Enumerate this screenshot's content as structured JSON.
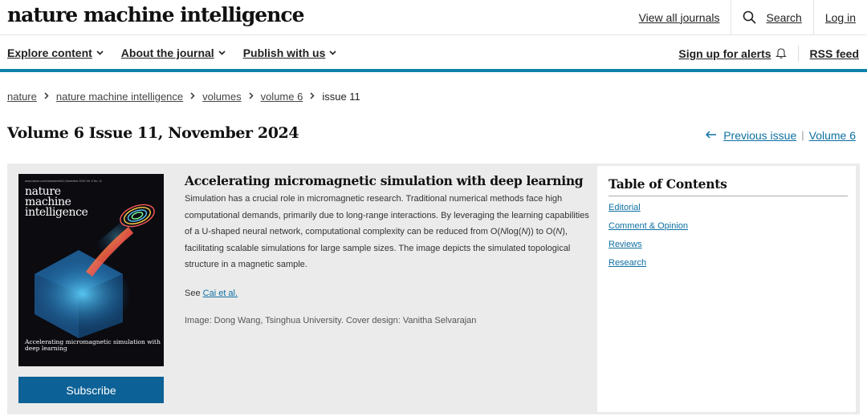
{
  "header": {
    "logo": "nature machine intelligence",
    "links": {
      "view_all": "View all journals",
      "search": "Search",
      "login": "Log in"
    }
  },
  "nav": {
    "items": [
      "Explore content",
      "About the journal",
      "Publish with us"
    ],
    "alerts": "Sign up for alerts",
    "rss": "RSS feed"
  },
  "breadcrumb": [
    "nature",
    "nature machine intelligence",
    "volumes",
    "volume 6",
    "issue 11"
  ],
  "page": {
    "title": "Volume 6 Issue 11, November 2024",
    "previous_issue": "Previous issue",
    "volume_link": "Volume 6"
  },
  "cover": {
    "top_text": "www.nature.com/natmachintell | November 2024 Vol. 6 No. 11",
    "title": "nature machine intelligence",
    "caption": "Accelerating micromagnetic simulation with deep learning",
    "subscribe": "Subscribe"
  },
  "article": {
    "title": "Accelerating micromagnetic simulation with deep learning",
    "desc_1": "Simulation has a crucial role in micromagnetic research. Traditional numerical methods face high computational demands, primarily due to long-range interactions. By leveraging the learning capabilities of a U-shaped neural network, computational complexity can be reduced from O(",
    "desc_n1": "N",
    "desc_2": "log(",
    "desc_n2": "N",
    "desc_3": ")) to O(",
    "desc_n3": "N",
    "desc_4": "), facilitating scalable simulations for large sample sizes. The image depicts the simulated topological structure in a magnetic sample.",
    "see_prefix": "See ",
    "see_link": "Cai et al.",
    "credit": "Image: Dong Wang, Tsinghua University. Cover design: Vanitha Selvarajan"
  },
  "toc": {
    "title": "Table of Contents",
    "items": [
      "Editorial",
      "Comment & Opinion",
      "Reviews",
      "Research"
    ]
  },
  "colors": {
    "accent": "#0e82a8",
    "link": "#0d6fa2",
    "subscribe_bg": "#0c6196",
    "panel_bg": "#ebebeb"
  }
}
